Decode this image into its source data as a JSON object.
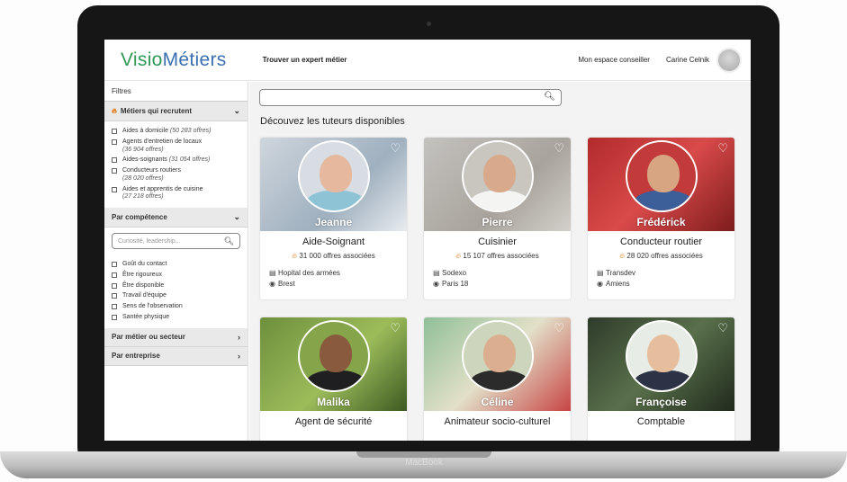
{
  "header": {
    "logo_a": "Visio",
    "logo_b": "Métiers",
    "nav_link": "Trouver un expert métier",
    "espace": "Mon espace conseiller",
    "user": "Carine Celnik"
  },
  "device_brand": "MacBook",
  "sidebar": {
    "filters_title": "Filtres",
    "sec_recrut": "Métiers qui recrutent",
    "recrut_items": [
      {
        "label": "Aides à domicile",
        "sub": "(50 283 offres)"
      },
      {
        "label": "Agents d'entretien de locaux",
        "sub": "(36 904 offres)"
      },
      {
        "label": "Aides-soignants",
        "sub": "(31 054 offres)"
      },
      {
        "label": "Conducteurs routiers",
        "sub": "(28 020 offres)"
      },
      {
        "label": "Aides et apprentis de cuisine",
        "sub": "(27 218 offres)"
      }
    ],
    "sec_comp": "Par compétence",
    "comp_search_placeholder": "Curiosité, leadership...",
    "comp_items": [
      "Goût du contact",
      "Être rigoureux",
      "Être disponible",
      "Travail d'équipe",
      "Sens de l'observation",
      "Santée physique"
    ],
    "sec_metier": "Par métier ou secteur",
    "sec_entreprise": "Par entreprise"
  },
  "main": {
    "search_value": "",
    "title": "Découvez les tuteurs disponibles",
    "cards": [
      {
        "name": "Jeanne",
        "job": "Aide-Soignant",
        "offers": "31 000 offres associées",
        "company": "Hopital des armées",
        "city": "Brest"
      },
      {
        "name": "Pierre",
        "job": "Cuisinier",
        "offers": "15 107 offres associées",
        "company": "Sodexo",
        "city": "Paris 18"
      },
      {
        "name": "Frédérick",
        "job": "Conducteur routier",
        "offers": "28 020 offres associées",
        "company": "Transdev",
        "city": "Amiens"
      },
      {
        "name": "Malika",
        "job": "Agent de sécurité"
      },
      {
        "name": "Céline",
        "job": "Animateur socio-culturel"
      },
      {
        "name": "Françoise",
        "job": "Comptable"
      }
    ]
  },
  "colors": {
    "logo_green": "#2e9a55",
    "logo_blue": "#3a6fb0",
    "flame": "#e07b1a",
    "accent_bg": "#f3f3f3"
  },
  "icons": [
    "search-icon",
    "heart-icon",
    "chevron-down-icon",
    "chevron-right-icon",
    "flame-icon",
    "building-icon",
    "location-icon"
  ]
}
